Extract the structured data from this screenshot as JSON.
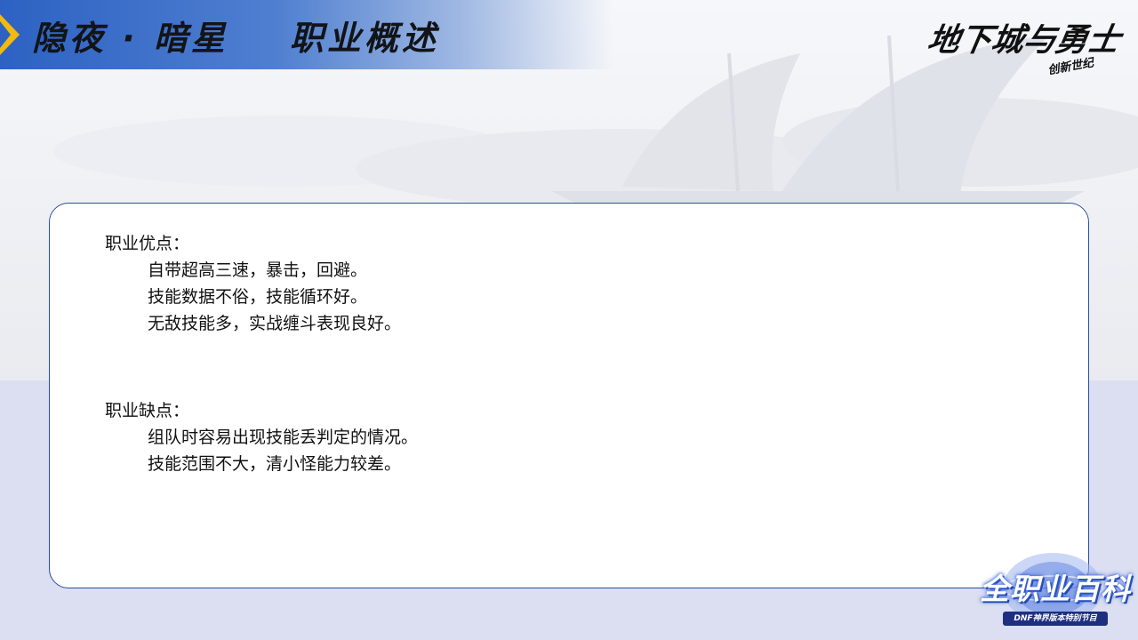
{
  "header": {
    "title": "隐夜 · 暗星    职业概述"
  },
  "logo": {
    "main": "地下城与勇士",
    "sub": "创新世纪"
  },
  "pros": {
    "title": "职业优点：",
    "items": [
      "自带超高三速，暴击，回避。",
      "技能数据不俗，技能循环好。",
      "无敌技能多，实战缠斗表现良好。"
    ]
  },
  "cons": {
    "title": "职业缺点：",
    "items": [
      "组队时容易出现技能丢判定的情况。",
      "技能范围不大，清小怪能力较差。"
    ]
  },
  "badge": {
    "main": "全职业百科",
    "sub": "DNF神界版本特别节目"
  },
  "colors": {
    "accent": "#2d62c3",
    "arrow": "#f2b90f",
    "card_border": "#2b4f9e"
  }
}
